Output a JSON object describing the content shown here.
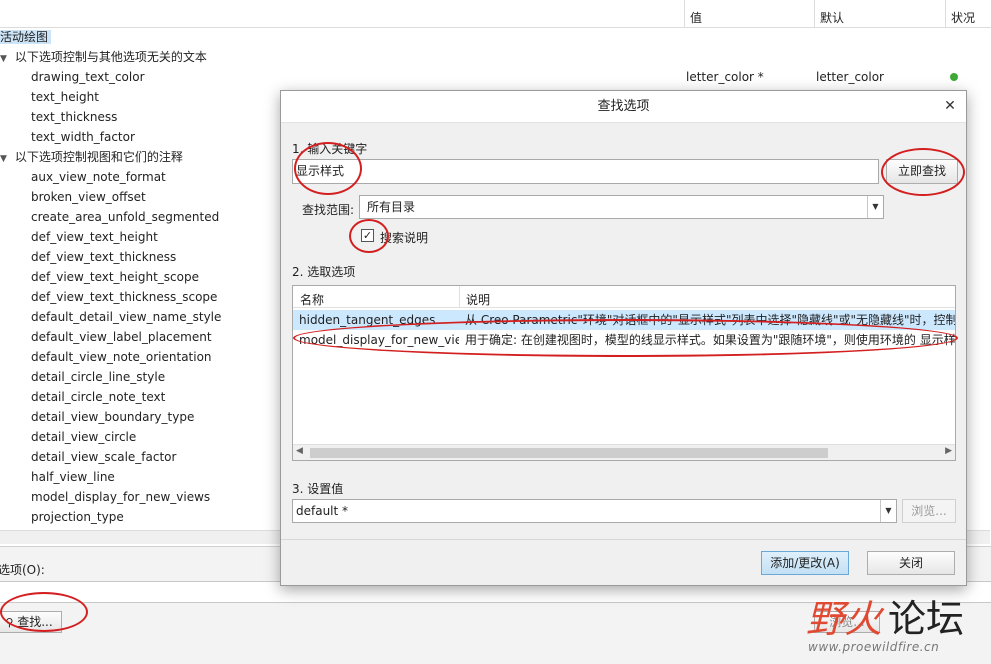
{
  "columns": {
    "value": "值",
    "default": "默认",
    "status": "状况"
  },
  "tree": {
    "root": "活动绘图",
    "group1": "以下选项控制与其他选项无关的文本",
    "group1_items": [
      {
        "name": "drawing_text_color",
        "value": "letter_color *",
        "default": "letter_color",
        "status_color": "#3eaa35"
      },
      {
        "name": "text_height"
      },
      {
        "name": "text_thickness"
      },
      {
        "name": "text_width_factor"
      }
    ],
    "group2": "以下选项控制视图和它们的注释",
    "group2_items": [
      "aux_view_note_format",
      "broken_view_offset",
      "create_area_unfold_segmented",
      "def_view_text_height",
      "def_view_text_thickness",
      "def_view_text_height_scope",
      "def_view_text_thickness_scope",
      "default_detail_view_name_style",
      "default_view_label_placement",
      "default_view_note_orientation",
      "detail_circle_line_style",
      "detail_circle_note_text",
      "detail_view_boundary_type",
      "detail_view_circle",
      "detail_view_scale_factor",
      "half_view_line",
      "model_display_for_new_views",
      "projection_type"
    ]
  },
  "bottom": {
    "option_label": "选项(O):",
    "find_button": "查找...",
    "browse_button": "浏览..."
  },
  "dialog": {
    "title": "查找选项",
    "close_icon": "close-icon",
    "step1": "1. 输入关键字",
    "keyword": "显示样式",
    "find_now": "立即查找",
    "scope_label": "查找范围:",
    "scope_value": "所有目录",
    "search_desc_label": "搜索说明",
    "search_desc_checked": true,
    "step2": "2. 选取选项",
    "list_headers": {
      "name": "名称",
      "desc": "说明"
    },
    "results": [
      {
        "name": "hidden_tangent_edges",
        "desc": "从 Creo Parametric\"环境\"对话框中的\"显示样式\"列表中选择\"隐藏线\"或\"无隐藏线\"时，控制相切边的显示。",
        "selected": true
      },
      {
        "name": "model_display_for_new_views",
        "desc": "用于确定: 在创建视图时，模型的线显示样式。如果设置为\"跟随环境\"，则使用环境的 显示样式。",
        "selected": false
      }
    ],
    "step3": "3. 设置值",
    "set_value": "default *",
    "browse_button": "浏览...",
    "add_change_button": "添加/更改(A)",
    "close_button": "关闭"
  },
  "watermark": {
    "brand_left": "野火",
    "brand_right": "论坛",
    "url": "www.proewildfire.cn"
  },
  "colors": {
    "annotation_red": "#d31f1f",
    "selection_blue": "#cce8ff",
    "brand_red": "#e04a32"
  }
}
